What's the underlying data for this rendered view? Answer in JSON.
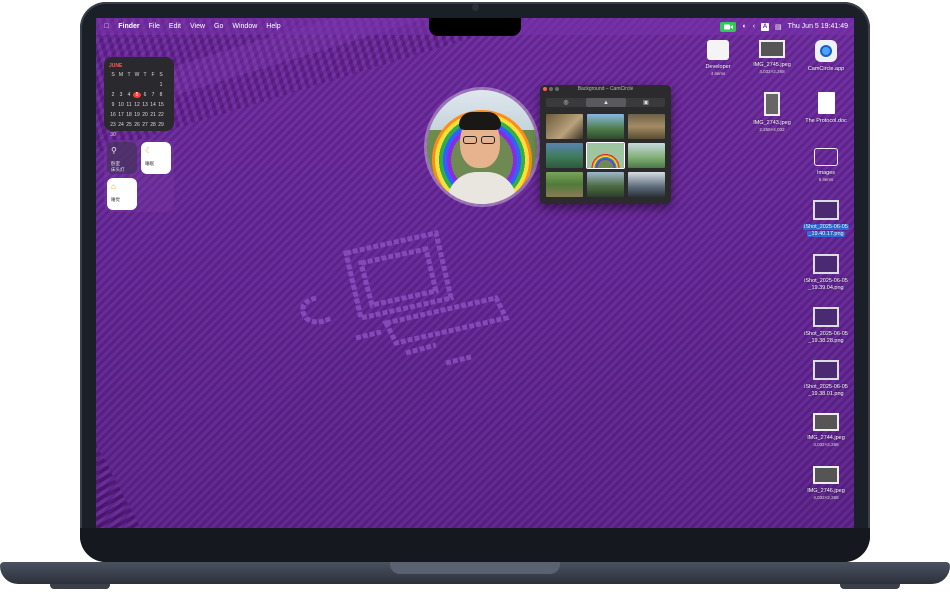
{
  "menubar": {
    "app_name": "Finder",
    "menus": [
      "File",
      "Edit",
      "View",
      "Go",
      "Window",
      "Help"
    ],
    "datetime": "Thu Jun 5  19:41:49",
    "input_source": "A"
  },
  "calendar": {
    "month": "JUNE",
    "weekdays": [
      "S",
      "M",
      "T",
      "W",
      "T",
      "F",
      "S"
    ],
    "days": [
      "1",
      "2",
      "3",
      "4",
      "5",
      "6",
      "7",
      "8",
      "9",
      "10",
      "11",
      "12",
      "13",
      "14",
      "15",
      "16",
      "17",
      "18",
      "19",
      "20",
      "21",
      "22",
      "23",
      "24",
      "25",
      "26",
      "27",
      "28",
      "29",
      "30"
    ],
    "today": "5"
  },
  "home": {
    "widget1_title": "卧室",
    "widget1_sub": "床头灯",
    "widget2_title": "睡眠",
    "widget3_title": "睡觉"
  },
  "camcircle_panel": {
    "title": "Background – CamCircle"
  },
  "desktop_items": [
    {
      "name": "Developer",
      "sub": "4 items"
    },
    {
      "name": "IMG_2745.jpeg",
      "sub": "4,032×2,268"
    },
    {
      "name": "CamCircle.app",
      "sub": ""
    },
    {
      "name": "IMG_2743.jpeg",
      "sub": "2,268×4,032"
    },
    {
      "name": "The Protocol.doc",
      "sub": ""
    },
    {
      "name": "Images",
      "sub": "6 items"
    },
    {
      "name": "iShot_2025-06-05",
      "name2": "_19.40.17.png",
      "sub": ""
    },
    {
      "name": "iShot_2025-06-05",
      "name2": "_19.39.04.png",
      "sub": ""
    },
    {
      "name": "iShot_2025-06-05",
      "name2": "_19.38.28.png",
      "sub": ""
    },
    {
      "name": "iShot_2025-06-05",
      "name2": "_19.38.01.png",
      "sub": ""
    },
    {
      "name": "IMG_2744.jpeg",
      "sub": "4,032×2,268"
    },
    {
      "name": "IMG_2746.jpeg",
      "sub": "4,032×2,268"
    }
  ],
  "colors": {
    "wallpaper": "#6a28a0",
    "camera_indicator": "#34c759",
    "selection": "#2f6fe0",
    "today_marker": "#ff3b30"
  }
}
